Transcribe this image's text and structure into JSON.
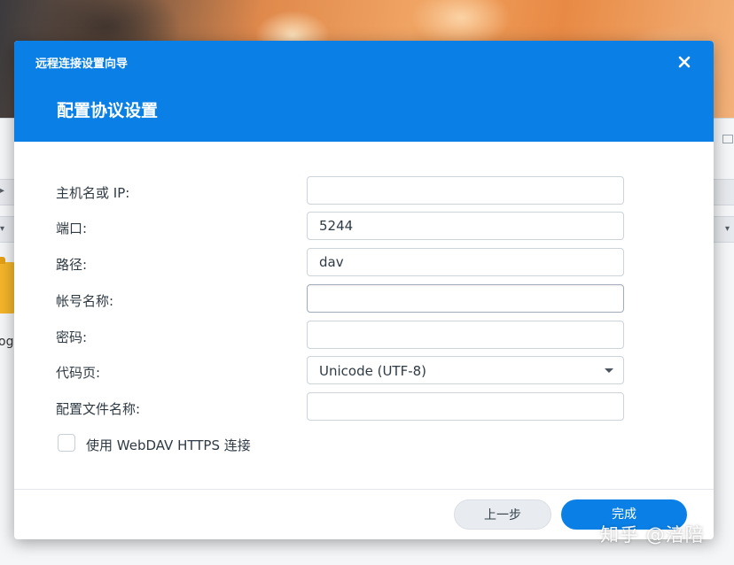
{
  "dialog": {
    "wizard_title": "远程连接设置向导",
    "step_title": "配置协议设置",
    "close_icon": "close-icon"
  },
  "form": {
    "host": {
      "label": "主机名或 IP:",
      "value": ""
    },
    "port": {
      "label": "端口:",
      "value": "5244"
    },
    "path": {
      "label": "路径:",
      "value": "dav"
    },
    "account": {
      "label": "帐号名称:",
      "value": ""
    },
    "password": {
      "label": "密码:",
      "value": ""
    },
    "codepage": {
      "label": "代码页:",
      "value": "Unicode (UTF-8)",
      "icon": "caret-down-icon"
    },
    "profile_name": {
      "label": "配置文件名称:",
      "value": ""
    },
    "https": {
      "label": "使用 WebDAV HTTPS 连接",
      "checked": false
    }
  },
  "footer": {
    "back_label": "上一步",
    "finish_label": "完成"
  },
  "background": {
    "file_label_fragment": "og"
  },
  "watermark": {
    "text": "知乎 @涪陪"
  },
  "colors": {
    "accent": "#0a80e6",
    "header_text": "#ffffff",
    "label_text": "#2f3a44"
  }
}
